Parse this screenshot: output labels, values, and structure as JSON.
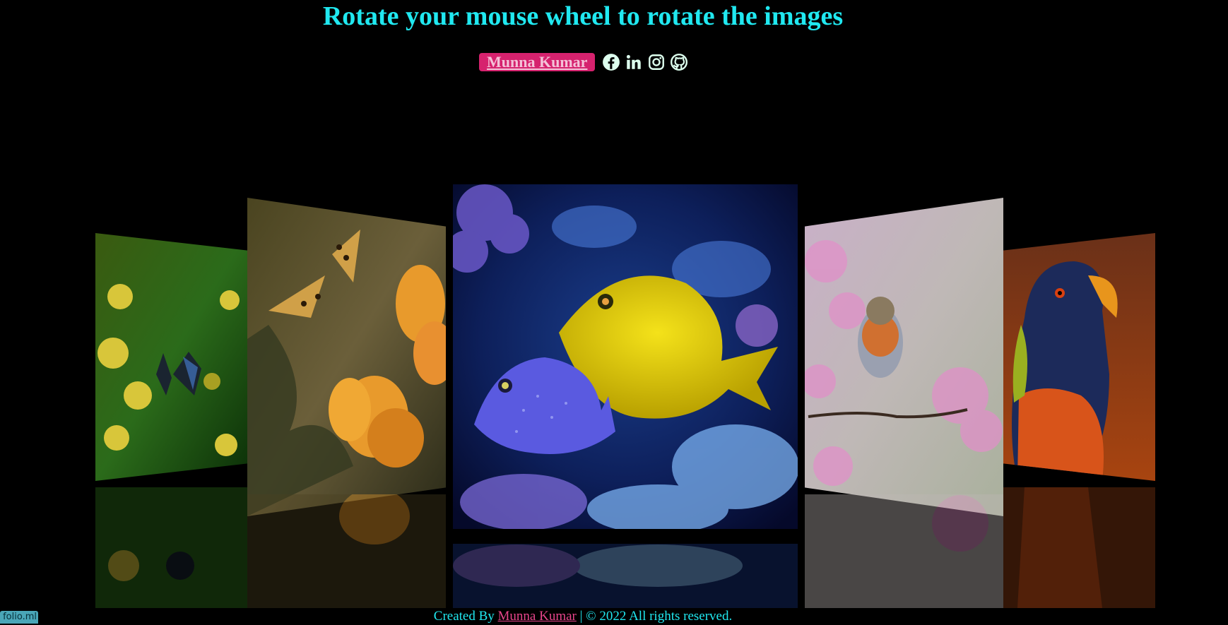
{
  "header": {
    "title": "Rotate your mouse wheel to rotate the images",
    "author_link": "Munna Kumar",
    "social_icons": [
      "facebook-icon",
      "linkedin-icon",
      "instagram-icon",
      "github-icon"
    ]
  },
  "gallery": {
    "images": [
      {
        "name": "butterfly-flowers-image",
        "subject": "blue butterfly on yellow flowers"
      },
      {
        "name": "butterfly-orange-flower-image",
        "subject": "orange butterfly on orange flower"
      },
      {
        "name": "fish-aquarium-image",
        "subject": "yellow and blue fish in coral reef"
      },
      {
        "name": "robin-blossom-image",
        "subject": "robin on cherry blossom branch"
      },
      {
        "name": "parrot-image",
        "subject": "rainbow lorikeet"
      }
    ]
  },
  "footer": {
    "prefix": "Created By",
    "author": "Munna Kumar",
    "suffix": "| © 2022 All rights reserved."
  },
  "corner_tag": "folio.ml",
  "colors": {
    "background": "#000000",
    "title": "#20e8f0",
    "accent": "#d6226e",
    "footer_link": "#e8458b"
  }
}
